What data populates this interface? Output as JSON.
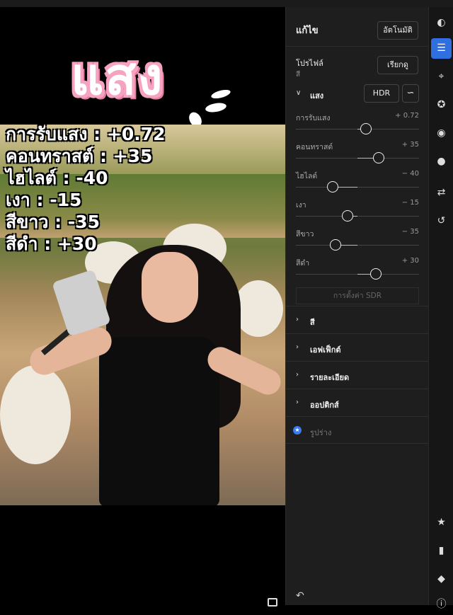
{
  "overlay": {
    "title_word": "แสง",
    "adjust_lines": [
      "การรับแสง : +0.72",
      "คอนทราสต์ : +35",
      "ไฮไลต์ : -40",
      "เงา : -15",
      "สีขาว : -35",
      "สีดำ : +30"
    ]
  },
  "panel": {
    "title": "แก้ไข",
    "auto_button": "อัตโนมัติ",
    "profile": {
      "label": "โปรไฟล์",
      "value": "สี",
      "browse_button": "เรียกดู"
    },
    "light_section": {
      "label": "แสง",
      "hdr_button": "HDR",
      "curve_icon": "tone-curve-icon",
      "sliders": [
        {
          "label": "การรับแสง",
          "value": "+ 0.72",
          "level": 0.57
        },
        {
          "label": "คอนทราสต์",
          "value": "+ 35",
          "level": 0.67
        },
        {
          "label": "ไฮไลต์",
          "value": "− 40",
          "level": 0.3
        },
        {
          "label": "เงา",
          "value": "− 15",
          "level": 0.42
        },
        {
          "label": "สีขาว",
          "value": "− 35",
          "level": 0.32
        },
        {
          "label": "สีดำ",
          "value": "+ 30",
          "level": 0.65
        }
      ],
      "sdr_button": "การตั้งค่า SDR"
    },
    "sections": [
      "สี",
      "เอฟเฟ็กต์",
      "รายละเอียด",
      "ออปติกส์"
    ],
    "shape_label": "รูปร่าง"
  },
  "rail_icons": [
    "presets-icon",
    "edit-sliders-icon",
    "crop-icon",
    "healing-icon",
    "masking-icon",
    "blur-icon",
    "versions-icon",
    "history-icon",
    "star-icon",
    "comment-icon",
    "tag-icon",
    "info-icon"
  ],
  "colors": {
    "accent": "#2f6fe0",
    "panel_bg": "#1e1e1e",
    "pink": "#f5a3c0"
  }
}
